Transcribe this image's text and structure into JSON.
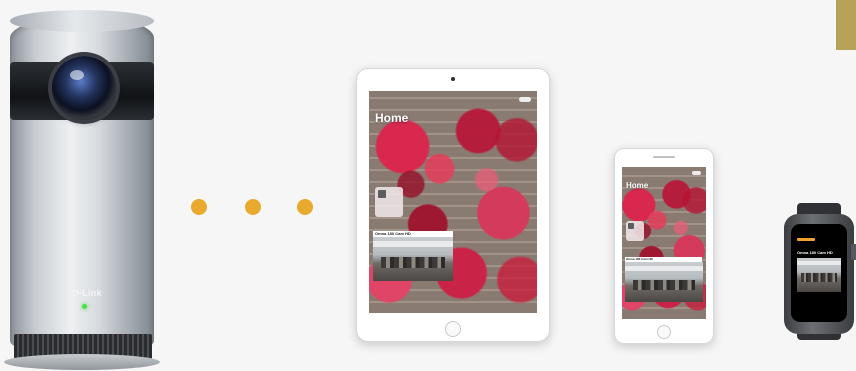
{
  "camera": {
    "brand_text": "D-Link"
  },
  "tablet": {
    "screen_title": "Home",
    "feed_label": "Omna 180 Cam HD"
  },
  "phone": {
    "screen_title": "Home",
    "feed_label": "Omna 180 Cam HD"
  },
  "watch": {
    "feed_label": "Omna 180 Cam HD"
  },
  "colors": {
    "background": "#f6f6f6",
    "connection_dots": "#e9a82e",
    "corner_accent": "#b7a357",
    "watch_accent": "#f0a22a"
  }
}
